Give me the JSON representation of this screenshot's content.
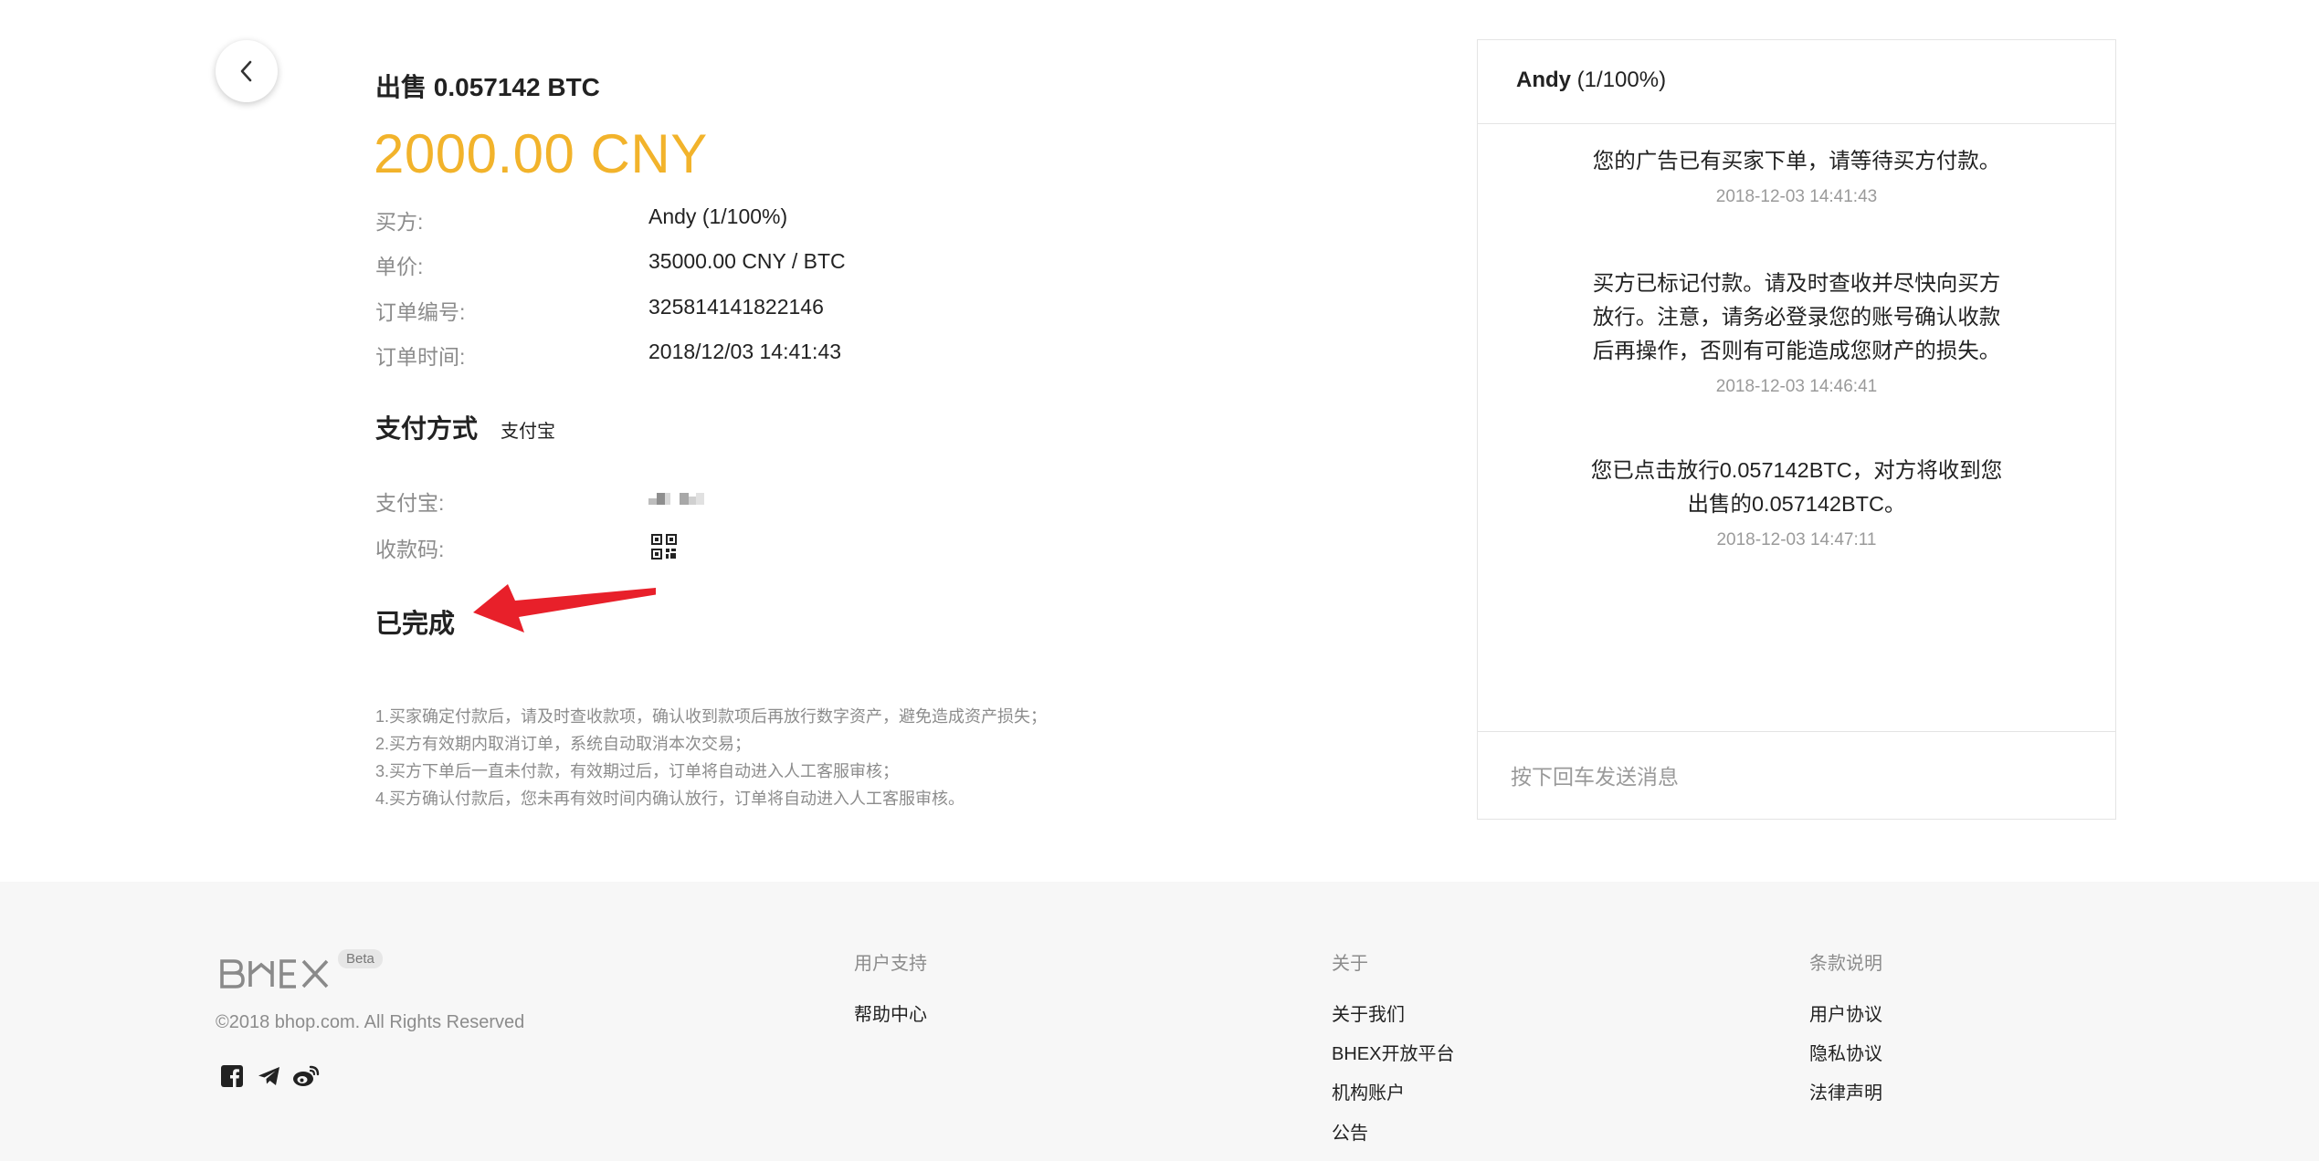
{
  "order": {
    "title": "出售 0.057142 BTC",
    "amount": "2000.00 CNY",
    "rows": [
      {
        "label": "买方:",
        "value": "Andy (1/100%)"
      },
      {
        "label": "单价:",
        "value": "35000.00 CNY / BTC"
      },
      {
        "label": "订单编号:",
        "value": "325814141822146"
      },
      {
        "label": "订单时间:",
        "value": "2018/12/03 14:41:43"
      }
    ]
  },
  "payment": {
    "title": "支付方式",
    "method": "支付宝",
    "account_label": "支付宝:",
    "qr_label": "收款码:"
  },
  "status": "已完成",
  "notes": [
    "1.买家确定付款后，请及时查收款项，确认收到款项后再放行数字资产，避免造成资产损失；",
    "2.买方有效期内取消订单，系统自动取消本次交易；",
    "3.买方下单后一直未付款，有效期过后，订单将自动进入人工客服审核；",
    "4.买方确认付款后，您未再有效时间内确认放行，订单将自动进入人工客服审核。"
  ],
  "chat": {
    "name": "Andy",
    "rating": "(1/100%)",
    "messages": [
      {
        "lines": [
          "您的广告已有买家下单，请等待买方付款。"
        ],
        "time": "2018-12-03 14:41:43"
      },
      {
        "lines": [
          "买方已标记付款。请及时查收并尽快向买方",
          "放行。注意，请务必登录您的账号确认收款",
          "后再操作，否则有可能造成您财产的损失。"
        ],
        "time": "2018-12-03 14:46:41"
      },
      {
        "lines": [
          "您已点击放行0.057142BTC，对方将收到您",
          "出售的0.057142BTC。"
        ],
        "time": "2018-12-03 14:47:11"
      }
    ],
    "input_placeholder": "按下回车发送消息"
  },
  "footer": {
    "logo": "BHEX",
    "beta": "Beta",
    "copyright": "©2018 bhop.com. All Rights Reserved",
    "columns": [
      {
        "title": "用户支持",
        "links": [
          "帮助中心"
        ]
      },
      {
        "title": "关于",
        "links": [
          "关于我们",
          "BHEX开放平台",
          "机构账户",
          "公告"
        ]
      },
      {
        "title": "条款说明",
        "links": [
          "用户协议",
          "隐私协议",
          "法律声明"
        ]
      }
    ],
    "social_icons": [
      "facebook-icon",
      "telegram-icon",
      "weibo-icon"
    ]
  },
  "colors": {
    "amount": "#f2b32b",
    "arrow": "#e8202a",
    "footer_bg": "#f7f7f7"
  }
}
